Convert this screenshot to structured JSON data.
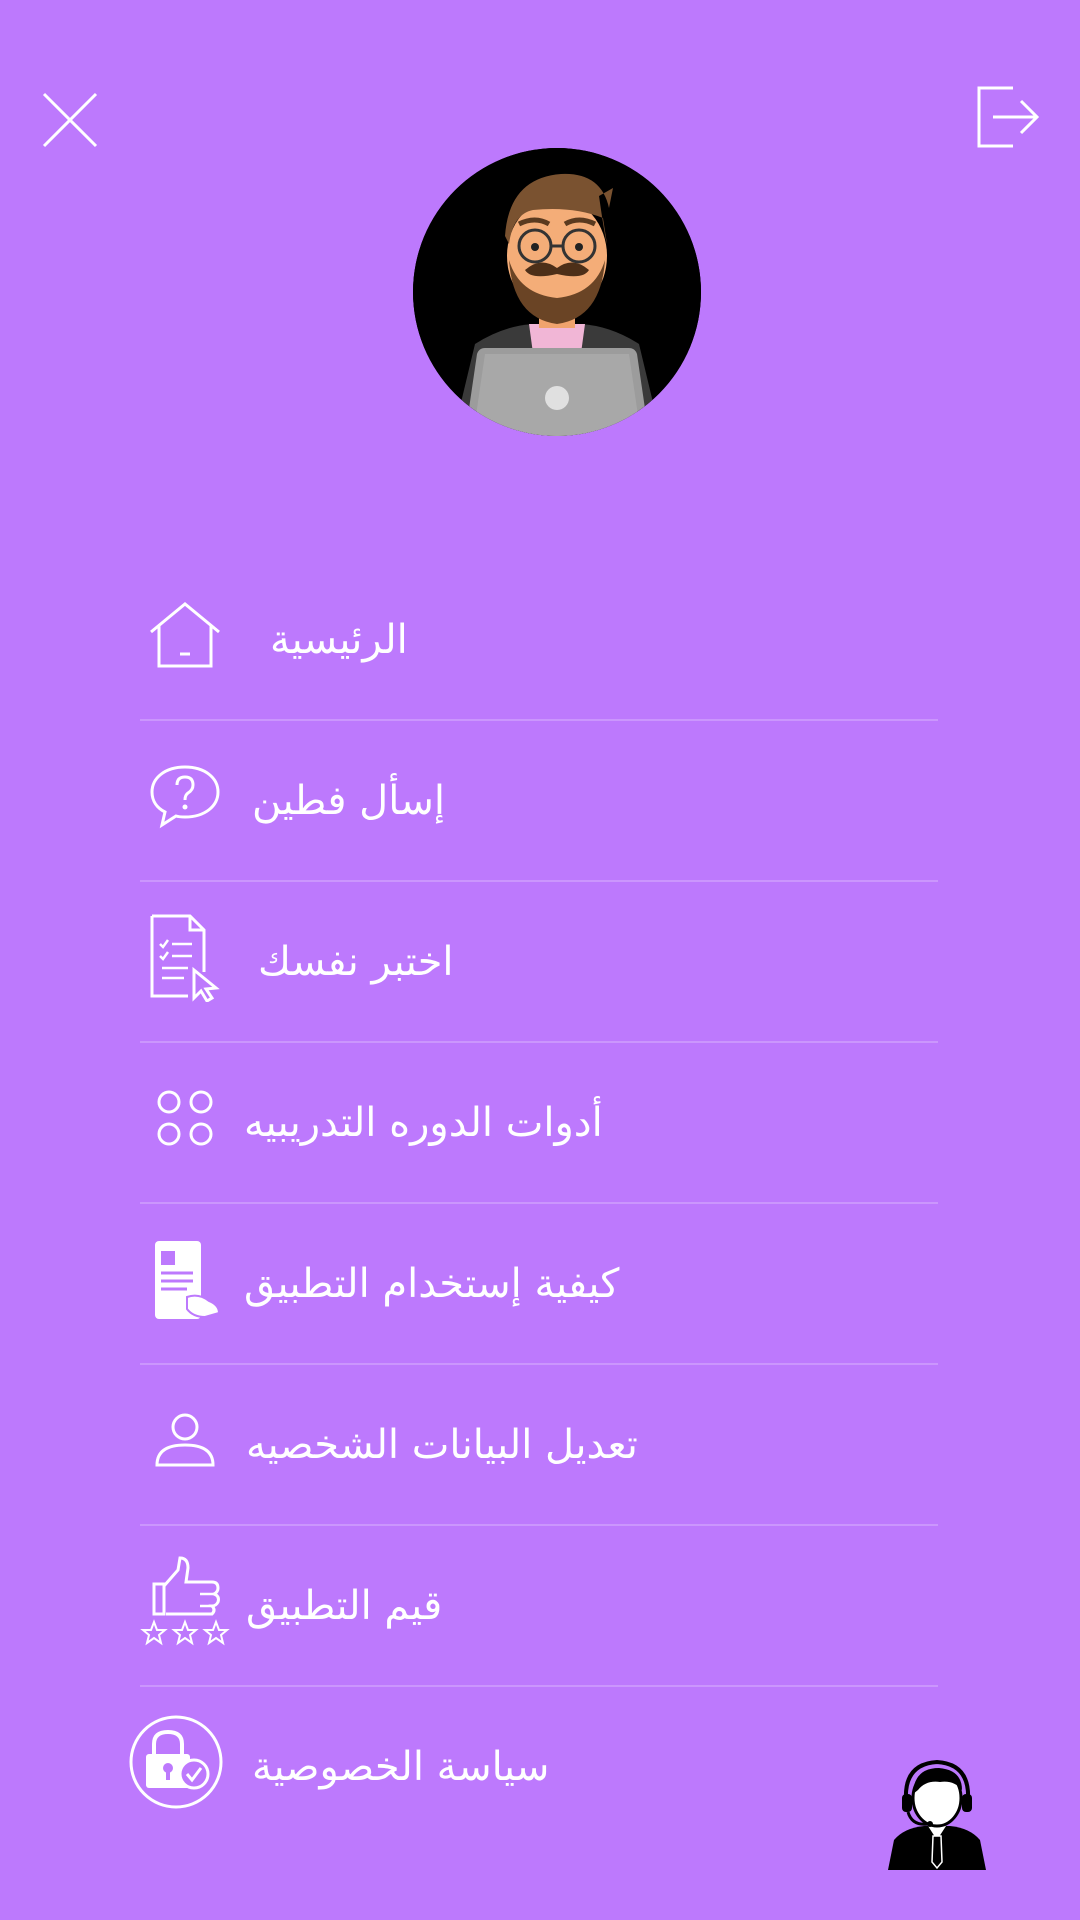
{
  "header": {
    "close_icon": "close-icon",
    "logout_icon": "logout-icon"
  },
  "profile": {
    "avatar_icon": "user-avatar"
  },
  "menu": {
    "items": [
      {
        "label": "الرئيسية",
        "icon": "home-icon"
      },
      {
        "label": "إسأل فطين",
        "icon": "question-chat-icon"
      },
      {
        "label": "اختبر نفسك",
        "icon": "quiz-document-icon"
      },
      {
        "label": "أدوات الدوره التدريبيه",
        "icon": "circles-grid-icon"
      },
      {
        "label": "كيفية إستخدام التطبيق",
        "icon": "phone-guide-icon"
      },
      {
        "label": "تعديل البيانات الشخصيه",
        "icon": "user-icon"
      },
      {
        "label": "قيم التطبيق",
        "icon": "thumbs-up-stars-icon"
      },
      {
        "label": "سياسة الخصوصية",
        "icon": "privacy-lock-icon"
      }
    ]
  },
  "support": {
    "icon": "customer-support-icon"
  },
  "colors": {
    "background": "#bd79fd",
    "foreground": "#ffffff"
  }
}
